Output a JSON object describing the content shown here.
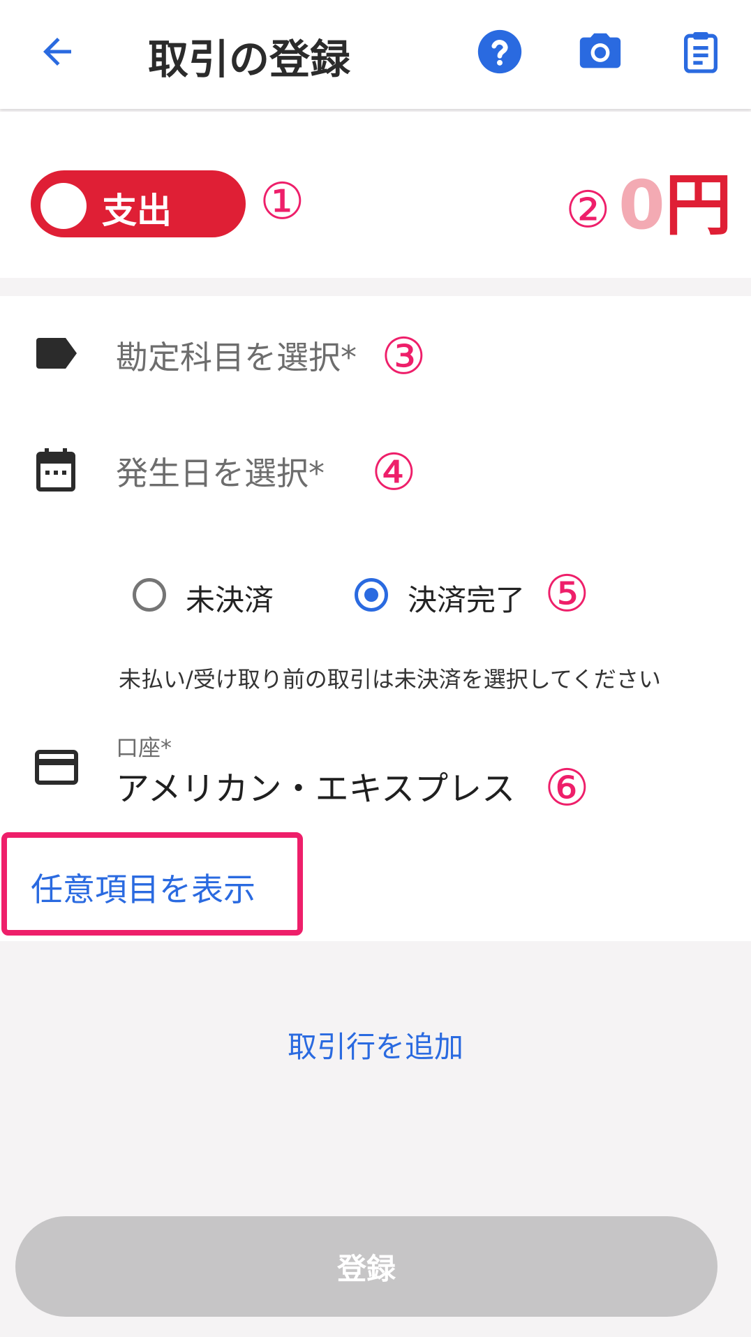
{
  "header": {
    "title": "取引の登録",
    "icons": [
      "arrow-back-icon",
      "help-icon",
      "camera-icon",
      "clipboard-icon"
    ],
    "accent_color": "#2a6ae0"
  },
  "type_toggle": {
    "label": "支出",
    "color": "#df1f35"
  },
  "amount": {
    "value": "0",
    "unit": "円"
  },
  "markers": {
    "m1": "①",
    "m2": "②",
    "m3": "③",
    "m4": "④",
    "m5": "⑤",
    "m6": "⑥"
  },
  "fields": {
    "account_item": {
      "placeholder": "勘定科目を選択*",
      "icon": "tag-icon"
    },
    "date": {
      "placeholder": "発生日を選択*",
      "icon": "calendar-icon"
    }
  },
  "settlement": {
    "options": [
      {
        "label": "未決済",
        "selected": false
      },
      {
        "label": "決済完了",
        "selected": true
      }
    ],
    "hint": "未払い/受け取り前の取引は未決済を選択してください"
  },
  "account": {
    "label": "口座*",
    "value": "アメリカン・エキスプレス",
    "icon": "credit-card-icon"
  },
  "optional_link": "任意項目を表示",
  "add_row_link": "取引行を追加",
  "submit_label": "登録",
  "highlight_color": "#ee1f6a"
}
